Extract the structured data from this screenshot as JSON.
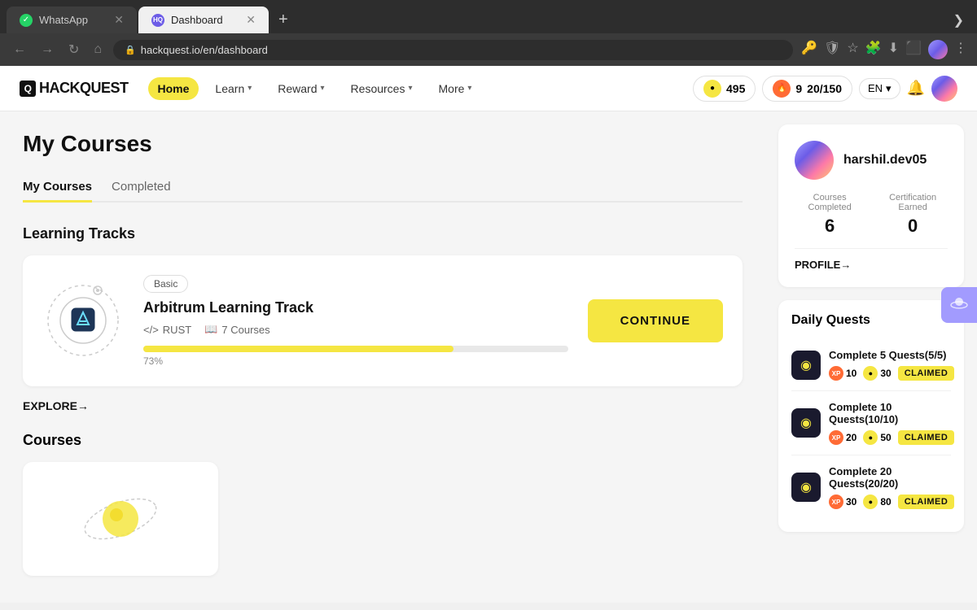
{
  "browser": {
    "tabs": [
      {
        "id": "whatsapp",
        "label": "WhatsApp",
        "favicon_type": "whatsapp",
        "active": false
      },
      {
        "id": "dashboard",
        "label": "Dashboard",
        "favicon_type": "hackquest",
        "active": true
      }
    ],
    "add_tab_label": "+",
    "tab_more_label": "❯",
    "address": "hackquest.io/en/dashboard",
    "lock_icon": "🔒"
  },
  "navbar": {
    "logo_text": "HACKQUEST",
    "items": [
      {
        "id": "home",
        "label": "Home",
        "active": true,
        "has_chevron": false
      },
      {
        "id": "learn",
        "label": "Learn",
        "active": false,
        "has_chevron": true
      },
      {
        "id": "reward",
        "label": "Reward",
        "active": false,
        "has_chevron": true
      },
      {
        "id": "resources",
        "label": "Resources",
        "active": false,
        "has_chevron": true
      },
      {
        "id": "more",
        "label": "More",
        "active": false,
        "has_chevron": true
      }
    ],
    "coins_value": "495",
    "streak_value": "9",
    "progress_value": "20/150",
    "lang": "EN"
  },
  "page": {
    "title": "My Courses",
    "tabs": [
      {
        "id": "my-courses",
        "label": "My Courses",
        "active": true
      },
      {
        "id": "completed",
        "label": "Completed",
        "active": false
      }
    ],
    "learning_tracks_title": "Learning Tracks",
    "track_card": {
      "badge": "Basic",
      "name": "Arbitrum Learning Track",
      "lang": "RUST",
      "courses_count": "7 Courses",
      "progress_pct": 73,
      "progress_label": "73%",
      "continue_label": "CONTINUE"
    },
    "explore_label": "EXPLORE→",
    "courses_title": "Courses"
  },
  "sidebar": {
    "profile": {
      "username": "harshil.dev05",
      "courses_completed_label": "Courses Completed",
      "courses_completed_value": "6",
      "cert_earned_label": "Certification Earned",
      "cert_earned_value": "0",
      "profile_link": "PROFILE→"
    },
    "daily_quests_title": "Daily Quests",
    "quests": [
      {
        "id": "q1",
        "label": "Complete 5 Quests(5/5)",
        "xp": "10",
        "coins": "30",
        "claimed": true,
        "claimed_label": "CLAIMED"
      },
      {
        "id": "q2",
        "label": "Complete 10 Quests(10/10)",
        "xp": "20",
        "coins": "50",
        "claimed": true,
        "claimed_label": "CLAIMED"
      },
      {
        "id": "q3",
        "label": "Complete 20 Quests(20/20)",
        "xp": "30",
        "coins": "80",
        "claimed": true,
        "claimed_label": "CLAIMED"
      }
    ]
  }
}
